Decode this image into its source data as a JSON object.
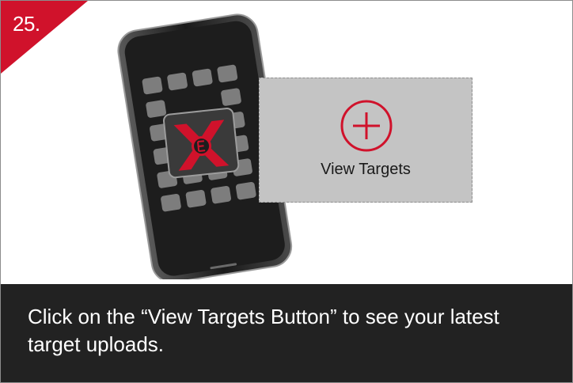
{
  "step": {
    "number": "25."
  },
  "target_button": {
    "label": "View Targets",
    "icon": "plus-circle-icon"
  },
  "caption": {
    "text": "Click on the “View Targets Button” to see your latest target uploads."
  },
  "phone": {
    "app_icon": "x-logo-icon"
  },
  "colors": {
    "accent": "#d0122b",
    "caption_bg": "#222222",
    "box_bg": "#c4c4c4"
  }
}
